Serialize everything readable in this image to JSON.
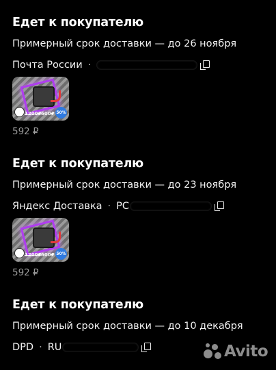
{
  "orders": [
    {
      "status": "Едет к покупателю",
      "eta": "Примерный срок доставки — до 26 ноября",
      "carrier": "Почта России",
      "track_prefix": "",
      "thumbnail": {
        "old_price": "1200₽",
        "new_price": "600₽",
        "discount": "50%"
      },
      "price": "592 ₽"
    },
    {
      "status": "Едет к покупателю",
      "eta": "Примерный срок доставки — до 23 ноября",
      "carrier": "Яндекс Доставка",
      "track_prefix": "РС",
      "thumbnail": {
        "old_price": "1200₽",
        "new_price": "600₽",
        "discount": "50%"
      },
      "price": "592 ₽"
    },
    {
      "status": "Едет к покупателю",
      "eta": "Примерный срок доставки — до 10 декабря",
      "carrier": "DPD",
      "track_prefix": "RU",
      "thumbnail": null,
      "price": ""
    }
  ],
  "separator": "·",
  "watermark": "Avito",
  "icons": {
    "copy": "copy-icon",
    "logo": "avito-logo-icon"
  },
  "colors": {
    "background": "#000000",
    "text": "#ffffff",
    "muted": "#9a9a9a",
    "accent_purple": "#b03cf0",
    "discount_blue": "#2f7ae0"
  }
}
